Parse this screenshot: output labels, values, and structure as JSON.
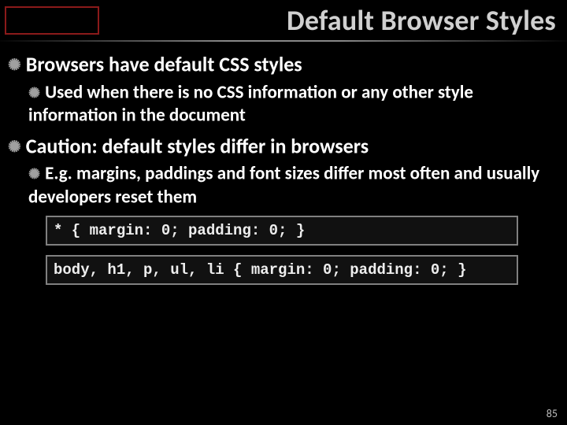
{
  "title": "Default Browser Styles",
  "bullets": {
    "b1": "Browsers have default CSS styles",
    "b1a": "Used when there is no CSS information or any other style information in the document",
    "b2": "Caution: default styles differ in browsers",
    "b2a": "E.g. margins, paddings and font sizes differ most often and usually developers reset them"
  },
  "code": {
    "c1": "* { margin: 0; padding: 0; }",
    "c2": "body, h1, p, ul, li { margin: 0; padding: 0; }"
  },
  "page_number": "85"
}
